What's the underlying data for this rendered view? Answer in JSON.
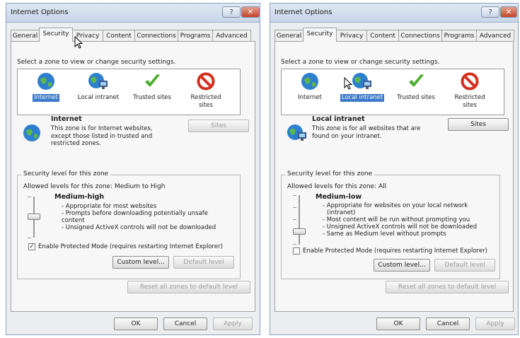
{
  "windows": [
    {
      "title": "Internet Options",
      "tabs": [
        "General",
        "Security",
        "Privacy",
        "Content",
        "Connections",
        "Programs",
        "Advanced"
      ],
      "active_tab": "Security",
      "prompt": "Select a zone to view or change security settings.",
      "zones": [
        {
          "label": "Internet",
          "icon": "globe-icon",
          "selected": true
        },
        {
          "label": "Local intranet",
          "icon": "intranet-icon",
          "selected": false
        },
        {
          "label": "Trusted sites",
          "icon": "checkmark-icon",
          "selected": false
        },
        {
          "label": "Restricted sites",
          "icon": "restricted-icon",
          "selected": false
        }
      ],
      "zone_heading": "Internet",
      "zone_description": "This zone is for Internet websites, except those listed in trusted and restricted zones.",
      "sites_label": "Sites",
      "sites_enabled": false,
      "level_group_label": "Security level for this zone",
      "allowed_levels": "Allowed levels for this zone: Medium to High",
      "level_name": "Medium-high",
      "level_bullets": [
        "- Appropriate for most websites",
        "- Prompts before downloading potentially unsafe",
        "content",
        "- Unsigned ActiveX controls will not be downloaded"
      ],
      "protected_mode_label": "Enable Protected Mode (requires restarting Internet Explorer)",
      "protected_mode_checked": true,
      "custom_level_label": "Custom level...",
      "default_level_label": "Default level",
      "reset_label": "Reset all zones to default level",
      "ok_label": "OK",
      "cancel_label": "Cancel",
      "apply_label": "Apply"
    },
    {
      "title": "Internet Options",
      "tabs": [
        "General",
        "Security",
        "Privacy",
        "Content",
        "Connections",
        "Programs",
        "Advanced"
      ],
      "active_tab": "Security",
      "prompt": "Select a zone to view or change security settings.",
      "zones": [
        {
          "label": "Internet",
          "icon": "globe-icon",
          "selected": false
        },
        {
          "label": "Local intranet",
          "icon": "intranet-icon",
          "selected": true
        },
        {
          "label": "Trusted sites",
          "icon": "checkmark-icon",
          "selected": false
        },
        {
          "label": "Restricted sites",
          "icon": "restricted-icon",
          "selected": false
        }
      ],
      "zone_heading": "Local intranet",
      "zone_description": "This zone is for all websites that are found on your intranet.",
      "sites_label": "Sites",
      "sites_enabled": true,
      "level_group_label": "Security level for this zone",
      "allowed_levels": "Allowed levels for this zone: All",
      "level_name": "Medium-low",
      "level_bullets": [
        "- Appropriate for websites on your local network",
        "(intranet)",
        "- Most content will be run without prompting you",
        "- Unsigned ActiveX controls will not be downloaded",
        "- Same as Medium level without prompts"
      ],
      "protected_mode_label": "Enable Protected Mode (requires restarting Internet Explorer)",
      "protected_mode_checked": false,
      "custom_level_label": "Custom level...",
      "default_level_label": "Default level",
      "reset_label": "Reset all zones to default level",
      "ok_label": "OK",
      "cancel_label": "Cancel",
      "apply_label": "Apply"
    }
  ],
  "colors": {
    "selection": "#3b79c9",
    "globe": "#2e7fcf",
    "check": "#4caf2a",
    "restricted": "#d32f1f",
    "close": "#c4422a"
  }
}
